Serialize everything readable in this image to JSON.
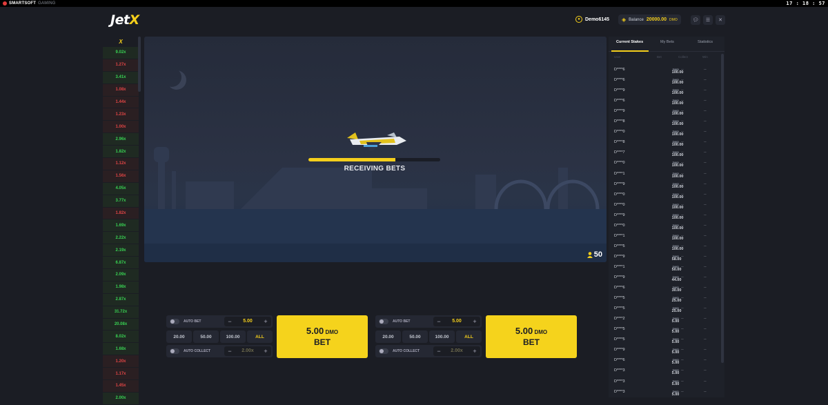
{
  "topbar": {
    "brand": "SMARTSOFT",
    "brand_suffix": "GAMING",
    "clock": "17 : 18 : 57"
  },
  "header": {
    "logo_main": "Jet",
    "logo_accent": "X",
    "username": "Demo6145",
    "balance_label": "Balance",
    "balance_value": "20000.00",
    "balance_currency": "DMO",
    "icons": [
      "chat-icon",
      "menu-icon",
      "close-icon"
    ]
  },
  "history": {
    "header": "X",
    "items": [
      {
        "v": "9.02x",
        "s": "g"
      },
      {
        "v": "1.27x",
        "s": "r"
      },
      {
        "v": "3.41x",
        "s": "g"
      },
      {
        "v": "1.08x",
        "s": "r"
      },
      {
        "v": "1.44x",
        "s": "r"
      },
      {
        "v": "1.23x",
        "s": "r"
      },
      {
        "v": "1.00x",
        "s": "r"
      },
      {
        "v": "2.96x",
        "s": "g"
      },
      {
        "v": "1.82x",
        "s": "g"
      },
      {
        "v": "1.12x",
        "s": "r"
      },
      {
        "v": "1.56x",
        "s": "r"
      },
      {
        "v": "4.05x",
        "s": "g"
      },
      {
        "v": "3.77x",
        "s": "g"
      },
      {
        "v": "1.82x",
        "s": "r"
      },
      {
        "v": "1.69x",
        "s": "g"
      },
      {
        "v": "2.22x",
        "s": "g"
      },
      {
        "v": "2.19x",
        "s": "g"
      },
      {
        "v": "6.87x",
        "s": "g"
      },
      {
        "v": "2.09x",
        "s": "g"
      },
      {
        "v": "1.98x",
        "s": "g"
      },
      {
        "v": "2.87x",
        "s": "g"
      },
      {
        "v": "31.72x",
        "s": "g"
      },
      {
        "v": "20.08x",
        "s": "g"
      },
      {
        "v": "8.02x",
        "s": "g"
      },
      {
        "v": "1.68x",
        "s": "g"
      },
      {
        "v": "1.20x",
        "s": "r"
      },
      {
        "v": "1.17x",
        "s": "r"
      },
      {
        "v": "1.45x",
        "s": "r"
      },
      {
        "v": "2.00x",
        "s": "g"
      }
    ]
  },
  "game": {
    "status": "RECEIVING BETS",
    "progress": 0.66,
    "players": "50"
  },
  "bet_panels": [
    {
      "auto_bet": "AUTO BET",
      "amount": "5.00",
      "chips": [
        "20.00",
        "50.00",
        "100.00",
        "ALL"
      ],
      "auto_collect": "AUTO COLLECT",
      "collect_value": "2.00x",
      "bet_amount": "5.00",
      "bet_currency": "DMO",
      "bet_label": "BET"
    },
    {
      "auto_bet": "AUTO BET",
      "amount": "5.00",
      "chips": [
        "20.00",
        "50.00",
        "100.00",
        "ALL"
      ],
      "auto_collect": "AUTO COLLECT",
      "collect_value": "2.00x",
      "bet_amount": "5.00",
      "bet_currency": "DMO",
      "bet_label": "BET"
    }
  ],
  "stakes": {
    "tabs": [
      "Current Stakes",
      "My Bets",
      "Statistics"
    ],
    "columns": [
      "User",
      "Bet",
      "Collect",
      "Win"
    ],
    "rows": [
      {
        "u": "D****6",
        "b": "100.00"
      },
      {
        "u": "D****6",
        "b": "100.00"
      },
      {
        "u": "D****9",
        "b": "100.00"
      },
      {
        "u": "D****6",
        "b": "100.00"
      },
      {
        "u": "D****9",
        "b": "100.00"
      },
      {
        "u": "D****8",
        "b": "100.00"
      },
      {
        "u": "D****0",
        "b": "100.00"
      },
      {
        "u": "D****8",
        "b": "100.00"
      },
      {
        "u": "D****7",
        "b": "100.00"
      },
      {
        "u": "D****0",
        "b": "100.00"
      },
      {
        "u": "D****1",
        "b": "100.00"
      },
      {
        "u": "D****9",
        "b": "100.00"
      },
      {
        "u": "D****0",
        "b": "100.00"
      },
      {
        "u": "D****0",
        "b": "100.00"
      },
      {
        "u": "D****9",
        "b": "100.00"
      },
      {
        "u": "D****0",
        "b": "100.00"
      },
      {
        "u": "D****1",
        "b": "100.00"
      },
      {
        "u": "D****5",
        "b": "100.00"
      },
      {
        "u": "D****9",
        "b": "58.00"
      },
      {
        "u": "D****1",
        "b": "50.00"
      },
      {
        "u": "D****9",
        "b": "44.00"
      },
      {
        "u": "D****6",
        "b": "30.00"
      },
      {
        "u": "D****5",
        "b": "25.00"
      },
      {
        "u": "D****5",
        "b": "25.00"
      },
      {
        "u": "D****2",
        "b": "5.00"
      },
      {
        "u": "D****5",
        "b": "5.00"
      },
      {
        "u": "D****5",
        "b": "5.00"
      },
      {
        "u": "D****9",
        "b": "5.00"
      },
      {
        "u": "D****6",
        "b": "5.00"
      },
      {
        "u": "D****3",
        "b": "5.00"
      },
      {
        "u": "D****3",
        "b": "5.00"
      },
      {
        "u": "D****3",
        "b": "5.00"
      }
    ],
    "currency": "DMO",
    "empty": "--"
  }
}
